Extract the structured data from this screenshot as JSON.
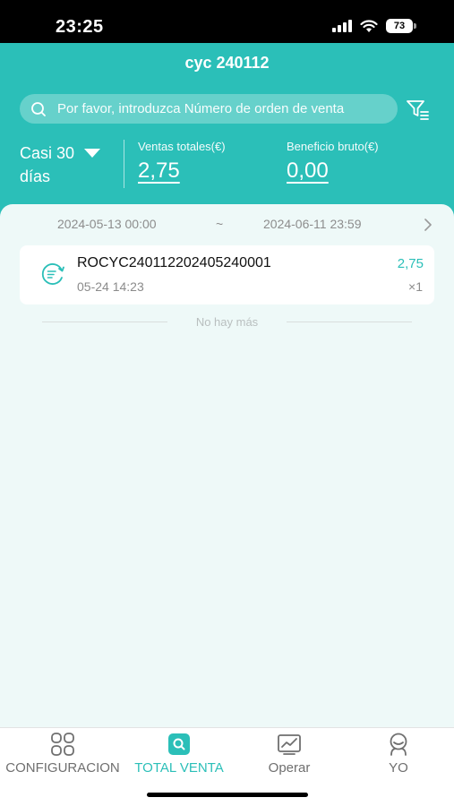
{
  "status_bar": {
    "time": "23:25",
    "battery": "73"
  },
  "header": {
    "title": "cyc 240112",
    "search": {
      "placeholder": "Por favor, introduzca Número de orden de venta"
    },
    "period": {
      "line1": "Casi 30",
      "line2": "días"
    },
    "stats": [
      {
        "label": "Ventas totales(€)",
        "value": "2,75"
      },
      {
        "label": "Beneficio bruto(€)",
        "value": "0,00"
      }
    ]
  },
  "date_range": {
    "start": "2024-05-13 00:00",
    "separator": "~",
    "end": "2024-06-11 23:59"
  },
  "orders": [
    {
      "id": "ROCYC240112202405240001",
      "time": "05-24 14:23",
      "amount": "2,75",
      "qty": "×1"
    }
  ],
  "list_end_text": "No hay más",
  "tabbar": {
    "tabs": [
      {
        "label": "CONFIGURACION",
        "icon": "grid-icon"
      },
      {
        "label": "TOTAL VENTA",
        "icon": "search-square-icon",
        "active": true
      },
      {
        "label": "Operar",
        "icon": "chart-icon"
      },
      {
        "label": "YO",
        "icon": "user-icon"
      }
    ]
  },
  "colors": {
    "accent": "#2bbfb8",
    "panel_bg": "#eef9f8",
    "muted_text": "#8b8b8b"
  }
}
